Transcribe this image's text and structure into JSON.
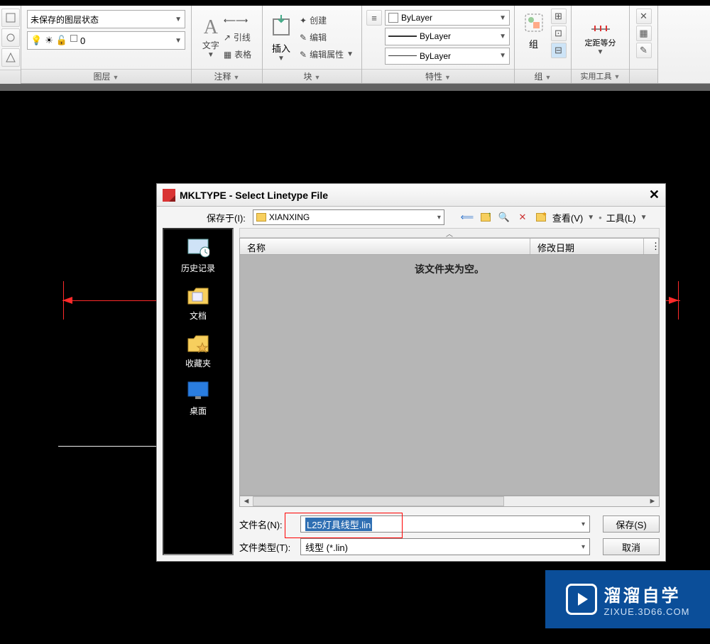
{
  "ribbon": {
    "layer": {
      "title": "图层",
      "unsaved_state": "未保存的图层状态",
      "layer0": "0"
    },
    "anno": {
      "title": "注释",
      "text_label": "文字",
      "leader": "引线",
      "table": "表格"
    },
    "block": {
      "title": "块",
      "insert": "插入",
      "create": "创建",
      "edit": "编辑",
      "attr_edit": "编辑属性"
    },
    "props": {
      "title": "特性",
      "bylayer1": "ByLayer",
      "bylayer2": "ByLayer",
      "bylayer3": "ByLayer"
    },
    "group": {
      "title": "组",
      "group_label": "组"
    },
    "equal": {
      "title": "定距等分",
      "label": "定距等分"
    },
    "util": {
      "title": "实用工具"
    }
  },
  "dialog": {
    "title": "MKLTYPE - Select Linetype File",
    "savein": "保存于(I):",
    "folder": "XIANXING",
    "view": "查看(V)",
    "tools": "工具(L)",
    "col_name": "名称",
    "col_date": "修改日期",
    "empty": "该文件夹为空。",
    "sidebar": {
      "history": "历史记录",
      "docs": "文档",
      "favs": "收藏夹",
      "desktop": "桌面"
    },
    "filename_label": "文件名(N):",
    "filename_value": "L25灯具线型.lin",
    "filetype_label": "文件类型(T):",
    "filetype_value": "线型 (*.lin)",
    "save_btn": "保存(S)",
    "cancel_btn": "取消"
  },
  "watermark": {
    "big": "溜溜自学",
    "small": "ZIXUE.3D66.COM"
  }
}
